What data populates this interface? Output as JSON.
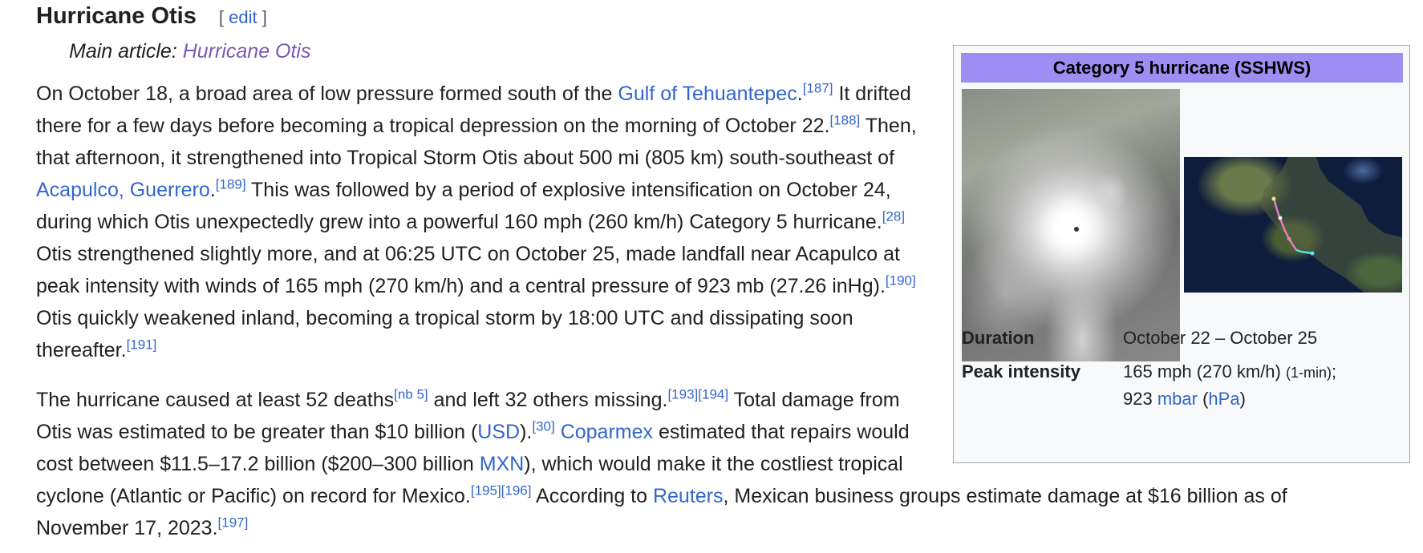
{
  "heading": {
    "title": "Hurricane Otis",
    "edit_open": "[",
    "edit_label": "edit",
    "edit_close": "]"
  },
  "hatnote": {
    "prefix": "Main article: ",
    "link": "Hurricane Otis"
  },
  "para1": {
    "l1_a": "On October 18, a broad area of low pressure formed south of the ",
    "l1_link": "Gulf of Tehuantepec",
    "l1_b": ".",
    "l1_ref": "[187]",
    "l1_c": " It drifted",
    "l2_a": "there for a few days before becoming a tropical depression on the morning of October 22.",
    "l2_ref": "[188]",
    "l2_b": " Then,",
    "l3": "that afternoon, it strengthened into Tropical Storm Otis about 500 mi (805 km) south-southeast of",
    "l4_link": "Acapulco, Guerrero",
    "l4_a": ".",
    "l4_ref": "[189]",
    "l4_b": " This was followed by a period of explosive intensification on October 24,",
    "l5_a": "during which Otis unexpectedly grew into a powerful 160 mph (260 km/h) Category 5 hurricane.",
    "l5_ref": "[28]",
    "l6": "Otis strengthened slightly more, and at 06:25 UTC on October 25, made landfall near Acapulco at",
    "l7_a": "peak intensity with winds of 165 mph (270 km/h) and a central pressure of 923 mb (27.26 inHg).",
    "l7_ref": "[190]",
    "l8": "Otis quickly weakened inland, becoming a tropical storm by 18:00 UTC and dissipating soon",
    "l9_a": "thereafter.",
    "l9_ref": "[191]"
  },
  "para2": {
    "l1_a": "The hurricane caused at least 52 deaths",
    "l1_ref1": "[nb 5]",
    "l1_b": " and left 32 others missing.",
    "l1_ref2": "[193]",
    "l1_ref3": "[194]",
    "l1_c": " Total damage from",
    "l2_a": "Otis was estimated to be greater than $10 billion (",
    "l2_link1": "USD",
    "l2_b": ").",
    "l2_ref": "[30]",
    "l2_sp": " ",
    "l2_link2": "Coparmex",
    "l2_c": " estimated that repairs would",
    "l3_a": "cost between $11.5–17.2 billion ($200–300 billion ",
    "l3_link": "MXN",
    "l3_b": "), which would make it the costliest tropical",
    "l4_a": "cyclone (Atlantic or Pacific) on record for Mexico.",
    "l4_ref1": "[195]",
    "l4_ref2": "[196]",
    "l4_b": " According to ",
    "l4_link": "Reuters",
    "l4_c": ", Mexican business groups estimate damage at $16 billion as of",
    "l5_a": "November 17, 2023.",
    "l5_ref": "[197]"
  },
  "infobox": {
    "header": "Category 5 hurricane (SSHWS)",
    "header_color": "#9e8ef3",
    "duration_label": "Duration",
    "duration_value": "October 22 – October 25",
    "peak_label": "Peak intensity",
    "peak_l1": "165 mph (270 km/h) ",
    "peak_small": "(1-min)",
    "peak_semicolon": ";",
    "peak_l2_a": "923 ",
    "peak_link1": "mbar",
    "peak_l2_b": " (",
    "peak_link2": "hPa",
    "peak_l2_c": ")"
  },
  "colors": {
    "link": "#3366cc",
    "visited_link": "#795cb2",
    "text": "#202122"
  }
}
